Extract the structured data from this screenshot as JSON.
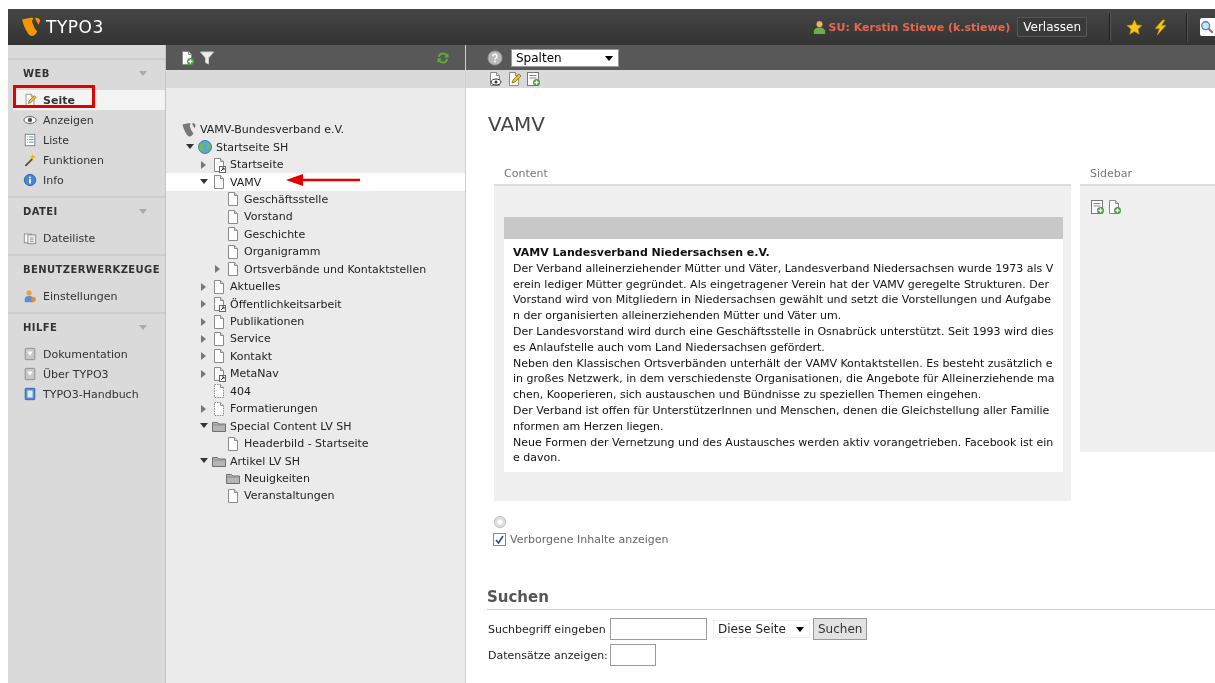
{
  "topbar": {
    "logo": "TYPO3",
    "user": "SU: Kerstin Stiewe (k.stiewe)",
    "exit_button": "Verlassen"
  },
  "module_menu": {
    "groups": [
      {
        "title": "WEB",
        "collapsible": true,
        "items": [
          {
            "label": "Seite",
            "selected": true
          },
          {
            "label": "Anzeigen",
            "selected": false
          },
          {
            "label": "Liste",
            "selected": false
          },
          {
            "label": "Funktionen",
            "selected": false
          },
          {
            "label": "Info",
            "selected": false
          }
        ]
      },
      {
        "title": "DATEI",
        "collapsible": true,
        "items": [
          {
            "label": "Dateiliste",
            "selected": false
          }
        ]
      },
      {
        "title": "BENUTZERWERKZEUGE",
        "collapsible": false,
        "items": [
          {
            "label": "Einstellungen",
            "selected": false
          }
        ]
      },
      {
        "title": "HILFE",
        "collapsible": true,
        "items": [
          {
            "label": "Dokumentation",
            "selected": false
          },
          {
            "label": "Über TYPO3",
            "selected": false
          },
          {
            "label": "TYPO3-Handbuch",
            "selected": false
          }
        ]
      }
    ]
  },
  "tree": {
    "nodes": [
      {
        "label": "VAMV-Bundesverband e.V.",
        "kind": "root",
        "selected": false,
        "children": [
          {
            "label": "Startseite SH",
            "kind": "site",
            "expanded": true,
            "selected": false,
            "children": [
              {
                "label": "Startseite",
                "kind": "shortcut",
                "expanded": false,
                "selected": false
              },
              {
                "label": "VAMV",
                "kind": "page",
                "expanded": true,
                "selected": true,
                "children": [
                  {
                    "label": "Geschäftsstelle",
                    "kind": "page",
                    "selected": false
                  },
                  {
                    "label": "Vorstand",
                    "kind": "page",
                    "selected": false
                  },
                  {
                    "label": "Geschichte",
                    "kind": "page",
                    "selected": false
                  },
                  {
                    "label": "Organigramm",
                    "kind": "page",
                    "selected": false
                  },
                  {
                    "label": "Ortsverbände und Kontaktstellen",
                    "kind": "page",
                    "expanded": false,
                    "selected": false
                  }
                ]
              },
              {
                "label": "Aktuelles",
                "kind": "page",
                "expanded": false,
                "selected": false
              },
              {
                "label": "Öffentlichkeitsarbeit",
                "kind": "shortcut",
                "expanded": false,
                "selected": false
              },
              {
                "label": "Publikationen",
                "kind": "page",
                "expanded": false,
                "selected": false
              },
              {
                "label": "Service",
                "kind": "page",
                "expanded": false,
                "selected": false
              },
              {
                "label": "Kontakt",
                "kind": "page",
                "expanded": false,
                "selected": false
              },
              {
                "label": "MetaNav",
                "kind": "shortcut",
                "expanded": false,
                "selected": false
              },
              {
                "label": "404",
                "kind": "hidden",
                "selected": false
              },
              {
                "label": "Formatierungen",
                "kind": "hidden",
                "expanded": false,
                "selected": false
              },
              {
                "label": "Special Content LV SH",
                "kind": "folder",
                "expanded": true,
                "selected": false,
                "children": [
                  {
                    "label": "Headerbild - Startseite",
                    "kind": "page",
                    "selected": false
                  }
                ]
              },
              {
                "label": "Artikel LV SH",
                "kind": "folder",
                "expanded": true,
                "selected": false,
                "children": [
                  {
                    "label": "Neuigkeiten",
                    "kind": "folder",
                    "selected": false
                  },
                  {
                    "label": "Veranstaltungen",
                    "kind": "page",
                    "selected": false
                  }
                ]
              }
            ]
          }
        ]
      }
    ]
  },
  "content_toolbar": {
    "view_select": "Spalten"
  },
  "page": {
    "title": "VAMV",
    "columns": [
      {
        "name": "Content",
        "elements": [
          {
            "heading": "VAMV Landesverband Niedersachsen e.V.",
            "paragraphs": [
              "Der Verband alleinerziehender Mütter und Väter, Landesverband Niedersachsen wurde 1973 als Verein lediger Mütter gegründet. Als eingetragener Verein hat der VAMV geregelte Strukturen. Der Vorstand wird von Mitgliedern in Niedersachsen gewählt und setzt die Vorstellungen und Aufgaben der organisierten alleinerziehenden Mütter und Väter um.",
              "Der Landesvorstand wird durch eine Geschäftsstelle in Osnabrück unterstützt. Seit 1993 wird dieses Anlaufstelle auch vom Land Niedersachsen gefördert.",
              "Neben den Klassischen Ortsverbänden unterhält der VAMV Kontaktstellen. Es besteht zusätzlich ein großes Netzwerk, in dem verschiedenste Organisationen, die Angebote für Alleinerziehende machen, Kooperieren, sich austauschen und Bündnisse zu speziellen Themen eingehen.",
              "Der Verband ist offen für UnterstützerInnen und Menschen, denen die Gleichstellung aller Familienformen am Herzen liegen.",
              "Neue Formen der Vernetzung und des Austausches werden aktiv vorangetrieben. Facebook ist eine davon."
            ]
          }
        ]
      },
      {
        "name": "Sidebar"
      }
    ]
  },
  "show_hidden": {
    "label": "Verborgene Inhalte anzeigen",
    "checked": true
  },
  "search": {
    "title": "Suchen",
    "term_label": "Suchbegriff eingeben",
    "scope": "Diese Seite",
    "button": "Suchen",
    "records_label": "Datensätze anzeigen:"
  }
}
